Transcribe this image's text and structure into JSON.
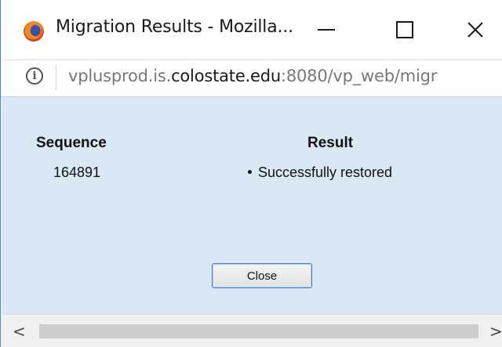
{
  "window": {
    "title": "Migration Results - Mozilla...",
    "min_glyph": "",
    "close_glyph": "✕"
  },
  "urlbar": {
    "url_prefix": "vplusprod.is.",
    "url_domain": "colostate.edu",
    "url_suffix": ":8080/vp_web/migr"
  },
  "table": {
    "headers": [
      "Sequence",
      "Result"
    ],
    "rows": [
      {
        "sequence": "164891",
        "result": "Successfully restored"
      }
    ]
  },
  "close_button_label": "Close",
  "scrollbar": {
    "left_glyph": "<",
    "right_glyph": ">"
  },
  "colors": {
    "content_bg": "#d9e8f4",
    "button_border": "#3d7bd0"
  }
}
